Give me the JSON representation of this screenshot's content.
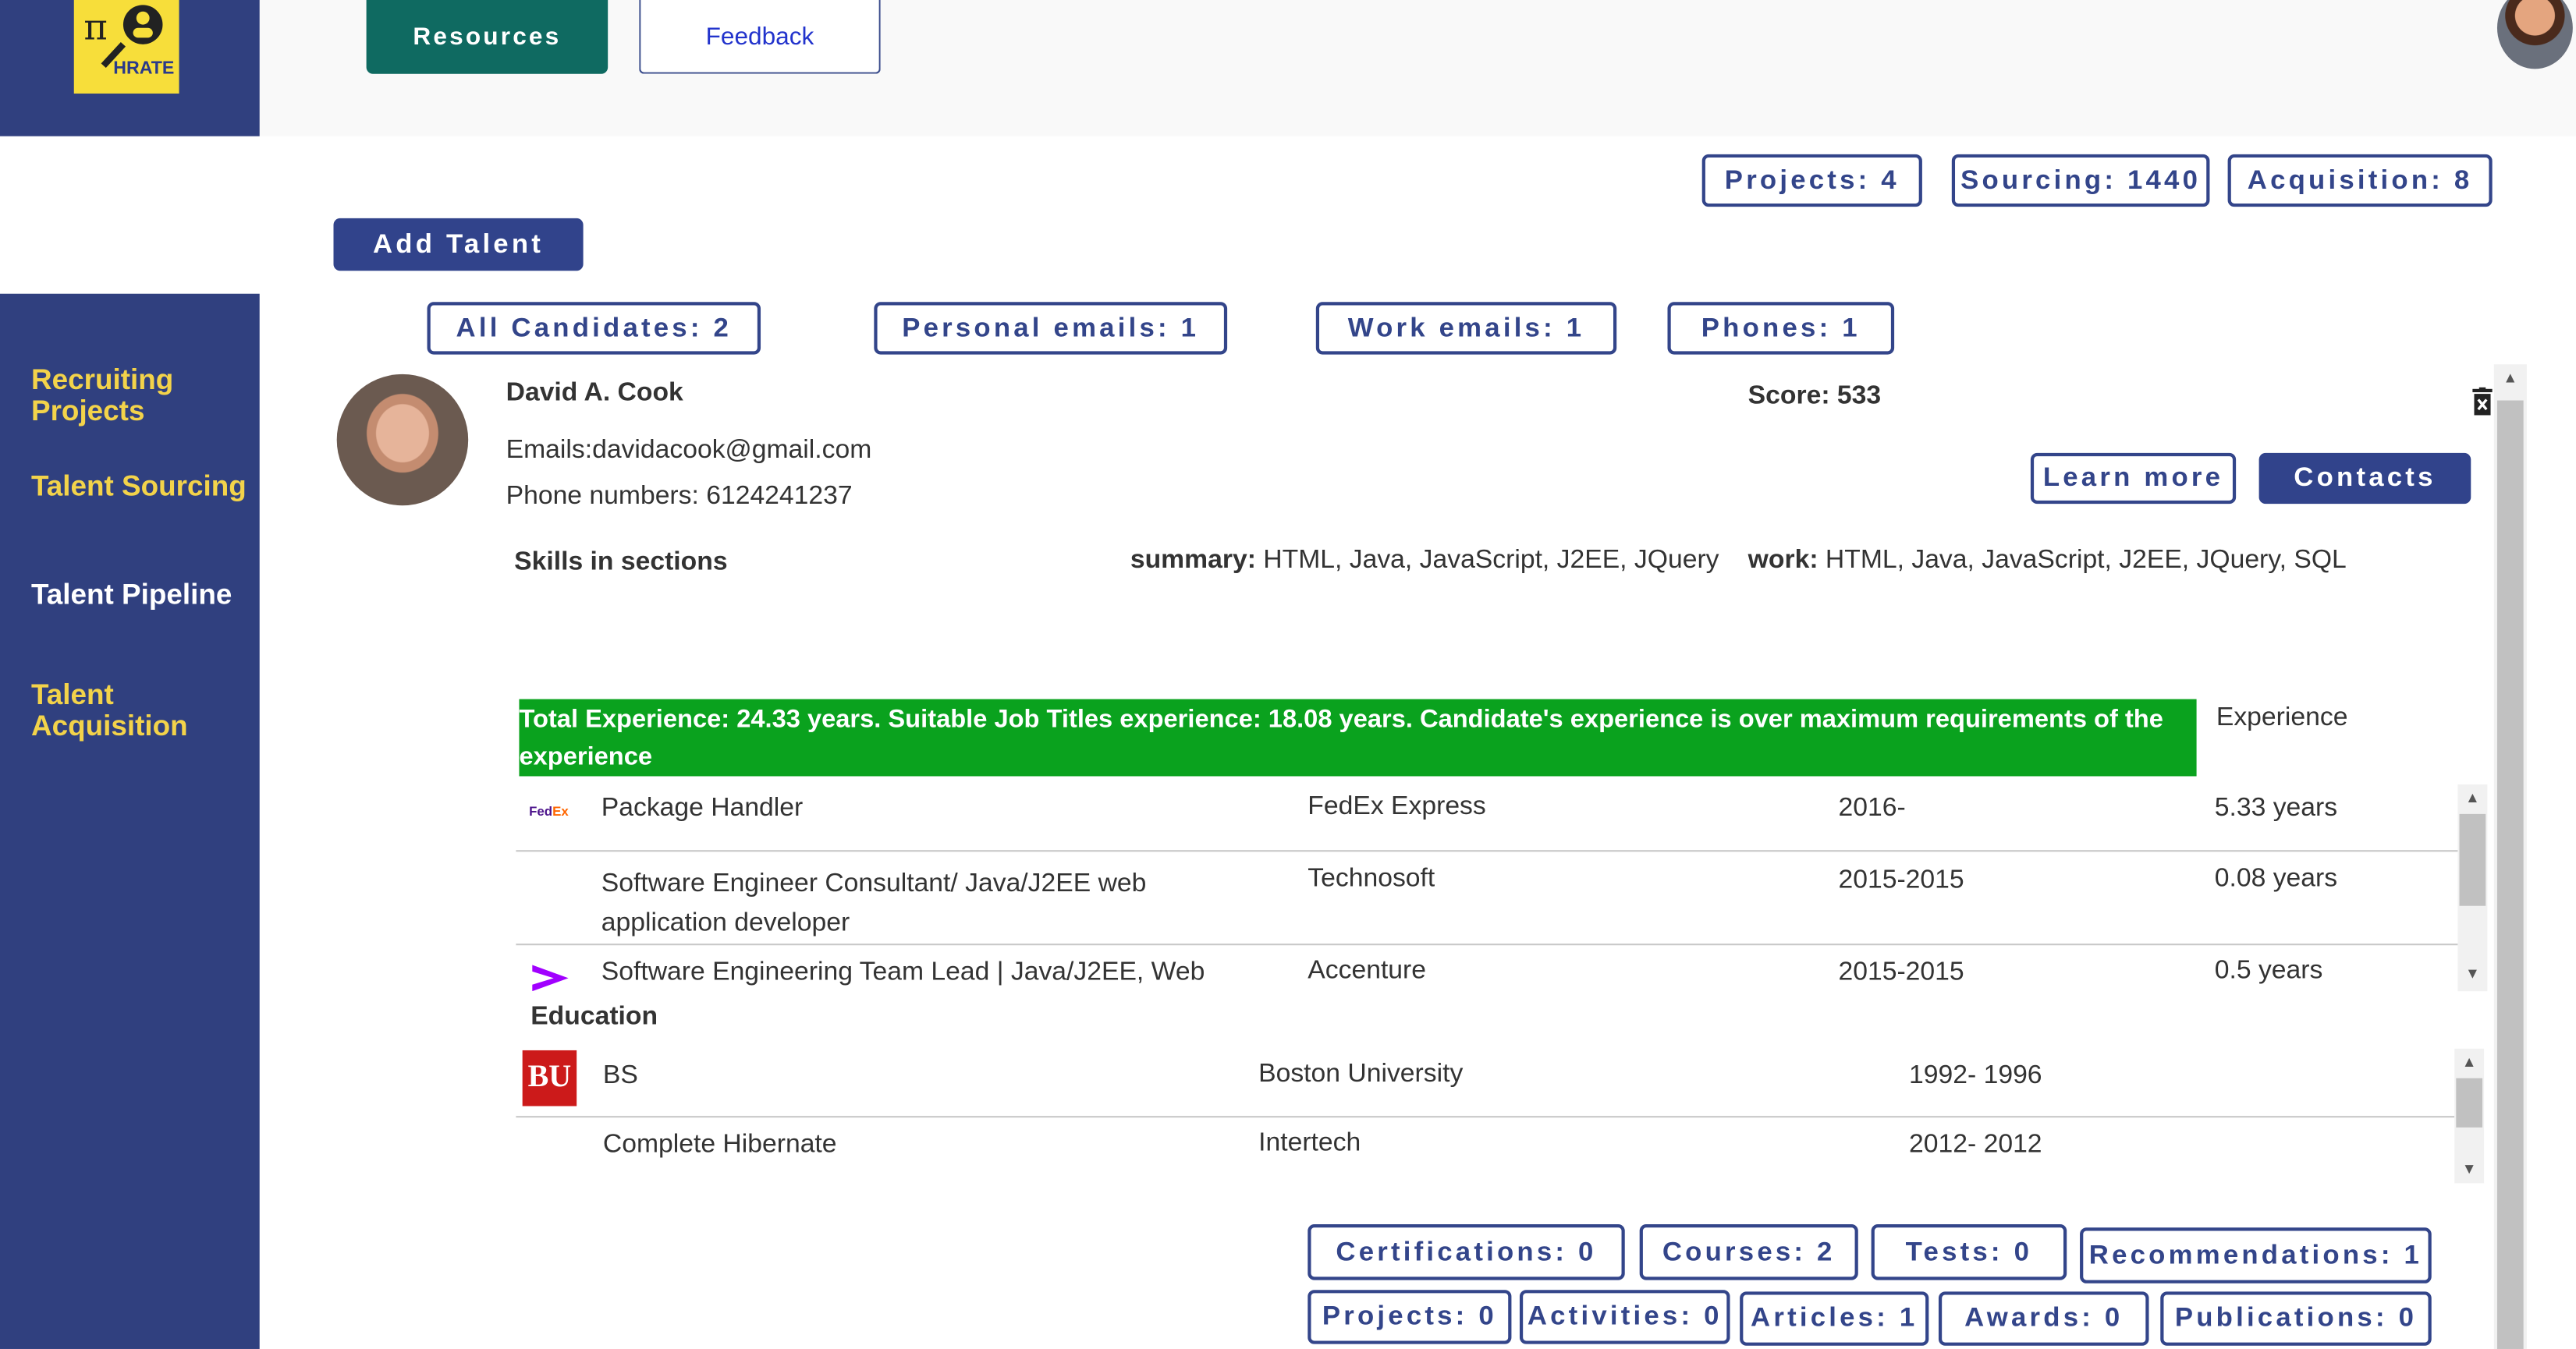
{
  "logo": {
    "text": "HRATE"
  },
  "header": {
    "resources_label": "Resources",
    "feedback_label": "Feedback"
  },
  "sidebar": {
    "items": [
      {
        "label": "Recruiting Projects"
      },
      {
        "label": "Talent Sourcing"
      },
      {
        "label": "Talent Pipeline"
      },
      {
        "label": "Talent Acquisition"
      }
    ]
  },
  "stats": {
    "projects": "Projects: 4",
    "sourcing": "Sourcing: 1440",
    "acquisition": "Acquisition: 8"
  },
  "add_talent_label": "Add Talent",
  "filters": {
    "all_candidates": "All Candidates: 2",
    "personal_emails": "Personal emails: 1",
    "work_emails": "Work emails: 1",
    "phones": "Phones: 1"
  },
  "candidate": {
    "name": "David A.  Cook",
    "score": "Score: 533",
    "emails": "Emails:davidacook@gmail.com",
    "phones": "Phone numbers: 6124241237",
    "learn_more": "Learn more",
    "contacts": "Contacts",
    "skills_title": "Skills in sections",
    "skills_summary_label": "summary:",
    "skills_summary_value": " HTML, Java, JavaScript, J2EE, JQuery",
    "skills_work_label": "work:",
    "skills_work_value": " HTML, Java, JavaScript, J2EE, JQuery, SQL",
    "experience_banner": "Total Experience: 24.33 years. Suitable Job Titles experience: 18.08 years. Candidate's experience is over maximum requirements of the experience",
    "experience_header": "Experience",
    "experience": [
      {
        "title": "Package Handler",
        "company": "FedEx Express",
        "dates": "2016-",
        "duration": "5.33 years",
        "logo": "fedex-logo"
      },
      {
        "title": "Software Engineer Consultant/ Java/J2EE web application developer",
        "company": "Technosoft",
        "dates": "2015-2015",
        "duration": "0.08 years",
        "logo": ""
      },
      {
        "title": "Software Engineering Team Lead | Java/J2EE, Web",
        "company": "Accenture",
        "dates": "2015-2015",
        "duration": "0.5 years",
        "logo": "accenture-logo"
      }
    ],
    "education_title": "Education",
    "education": [
      {
        "degree": "BS",
        "school": "Boston University",
        "dates": "1992- 1996",
        "logo": "bu-logo"
      },
      {
        "degree": "Complete Hibernate",
        "school": "Intertech",
        "dates": "2012- 2012",
        "logo": ""
      }
    ],
    "logos": {
      "fedex": "FedEx",
      "bu": "BU"
    }
  },
  "counts": {
    "certifications": "Certifications: 0",
    "courses": "Courses: 2",
    "tests": "Tests: 0",
    "recommendations": "Recommendations: 1",
    "projects": "Projects: 0",
    "activities": "Activities: 0",
    "articles": "Articles: 1",
    "awards": "Awards: 0",
    "publications": "Publications: 0"
  },
  "colors": {
    "sidebar": "#30407f",
    "accent_yellow": "#f3d34a",
    "resources": "#0f6a61",
    "banner_green": "#0aa21e",
    "pill_border": "#33458a"
  }
}
